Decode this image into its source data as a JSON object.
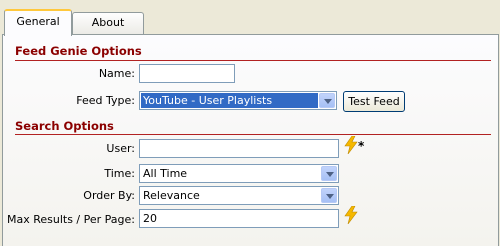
{
  "tabs": [
    {
      "label": "General",
      "active": true
    },
    {
      "label": "About",
      "active": false
    }
  ],
  "feed_genie": {
    "title": "Feed Genie Options",
    "name_label": "Name:",
    "name_value": "",
    "feed_type_label": "Feed Type:",
    "feed_type_selected": "YouTube - User Playlists",
    "test_feed_label": "Test Feed"
  },
  "search_options": {
    "title": "Search Options",
    "user_label": "User:",
    "user_value": "",
    "required_marker": "*",
    "time_label": "Time:",
    "time_selected": "All Time",
    "order_label": "Order By:",
    "order_selected": "Relevance",
    "max_results_label": "Max Results / Per Page:",
    "max_results_value": "20"
  },
  "colors": {
    "section_title": "#8b0000",
    "section_rule": "#b22222",
    "selection": "#316ac5",
    "tab_highlight": "#ffc83c",
    "bolt": "#f5b800"
  },
  "icons": [
    "lightning-bolt-icon",
    "chevron-down-icon"
  ]
}
